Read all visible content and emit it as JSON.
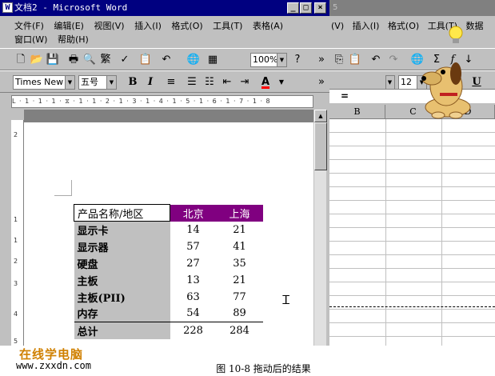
{
  "word": {
    "title": "文档2 - Microsoft Word",
    "app_icon": "W",
    "controls": {
      "minimize": "_",
      "maximize": "□",
      "close": "×"
    },
    "menu": [
      "文件(F)",
      "编辑(E)",
      "视图(V)",
      "插入(I)",
      "格式(O)",
      "工具(T)",
      "表格(A)",
      "窗口(W)",
      "帮助(H)"
    ],
    "toolbar": {
      "zoom": "100%",
      "traditional_label": "繁"
    },
    "format_toolbar": {
      "font": "Times New Ro",
      "size": "五号",
      "bold": "B",
      "italic": "I",
      "underline_color": "A"
    },
    "ruler_text": "L · 1 · 1 · 1 · ⧖ · 1 · 1 · 2 · 1 · 3 · 1 · 4 · 1 · 5 · 1 · 6 · 1 · 7 · 1 · 8",
    "vruler_ticks": [
      "2",
      "1",
      "1",
      "2",
      "3",
      "4",
      "5"
    ],
    "table": {
      "header_name": "产品名称/地区",
      "columns": [
        "北京",
        "上海"
      ],
      "rows": [
        {
          "name": "显示卡",
          "values": [
            "14",
            "21"
          ]
        },
        {
          "name": "显示器",
          "values": [
            "57",
            "41"
          ]
        },
        {
          "name": "硬盘",
          "values": [
            "27",
            "35"
          ]
        },
        {
          "name": "主板",
          "values": [
            "13",
            "21"
          ]
        },
        {
          "name": "主板(PII)",
          "values": [
            "63",
            "77"
          ]
        },
        {
          "name": "内存",
          "values": [
            "54",
            "89"
          ]
        }
      ],
      "total": {
        "name": "总计",
        "values": [
          "228",
          "284"
        ]
      }
    }
  },
  "excel": {
    "menu": [
      "(V)",
      "插入(I)",
      "格式(O)",
      "工具(T)",
      "数据"
    ],
    "font_size": "12",
    "formula_eq": "=",
    "columns": [
      "B",
      "C",
      "D"
    ],
    "title_fragment": "5"
  },
  "assistant": {
    "name": "dog-office-assistant",
    "icon": "lightbulb-icon"
  },
  "caption": {
    "site_cn": "在线学电脑",
    "site_url": "www.zxxdn.com",
    "figure": "图 10-8 拖动后的结果"
  },
  "colors": {
    "title_active": "#000080",
    "header_fill": "#800080",
    "face": "#c0c0c0",
    "logo": "#d08000"
  }
}
